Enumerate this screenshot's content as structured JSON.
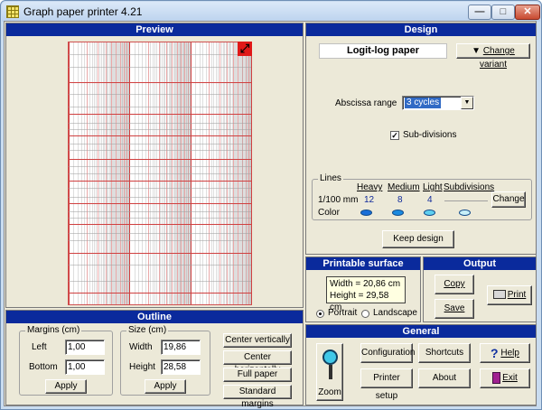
{
  "window": {
    "title": "Graph paper printer 4.21",
    "min_label": "—",
    "max_label": "□",
    "close_label": "✕"
  },
  "preview": {
    "header": "Preview",
    "resize_label": "⤢"
  },
  "outline": {
    "header": "Outline",
    "margins": {
      "label": "Margins (cm)",
      "left_label": "Left",
      "left_value": "1,00",
      "bottom_label": "Bottom",
      "bottom_value": "1,00",
      "apply_label": "Apply"
    },
    "size": {
      "label": "Size (cm)",
      "width_label": "Width",
      "width_value": "19,86",
      "height_label": "Height",
      "height_value": "28,58",
      "apply_label": "Apply"
    },
    "buttons": {
      "center_vertically": "Center vertically",
      "center_horizontally": "Center horizontally",
      "full_paper": "Full paper",
      "standard_margins": "Standard margins"
    }
  },
  "design": {
    "header": "Design",
    "paper_type": "Logit-log paper",
    "change_variant_label": "Change variant",
    "abscissa_label": "Abscissa range",
    "abscissa_value": "3 cycles",
    "subdivisions_label": "Sub-divisions",
    "subdivisions_checked": true,
    "lines": {
      "label": "Lines",
      "heavy_label": "Heavy",
      "medium_label": "Medium",
      "light_label": "Light",
      "subdivisions_label": "Subdivisions",
      "unit_label": "1/100 mm",
      "heavy_value": "12",
      "medium_value": "8",
      "light_value": "4",
      "color_label": "Color",
      "change_label": "Change",
      "heavy_color": "#1a6fd8",
      "medium_color": "#1a8ae0",
      "light_color": "#5fd0f0",
      "sub_color": "#c8f0f8"
    },
    "keep_design_label": "Keep design"
  },
  "printable": {
    "header": "Printable surface",
    "width_text": "Width = 20,86 cm",
    "height_text": "Height = 29,58 cm",
    "portrait_label": "Portrait",
    "landscape_label": "Landscape",
    "orientation": "portrait"
  },
  "output": {
    "header": "Output",
    "copy_label": "Copy",
    "save_label": "Save",
    "print_label": "Print"
  },
  "general": {
    "header": "General",
    "zoom_label": "Zoom",
    "configuration_label": "Configuration",
    "shortcuts_label": "Shortcuts",
    "help_label": "Help",
    "printer_setup_label": "Printer setup",
    "about_label": "About",
    "exit_label": "Exit"
  },
  "colors": {
    "header_bg": "#0a2a9c",
    "grid": "#d04040",
    "face": "#ece9d8"
  }
}
